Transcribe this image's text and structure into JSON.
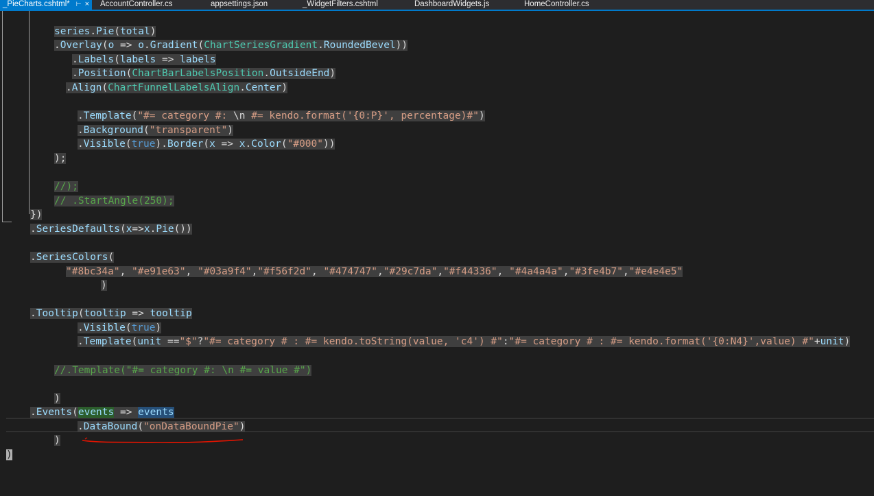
{
  "tabs": [
    {
      "label": "_PieCharts.cshtml*",
      "active": true,
      "pin_icon": "pin-icon",
      "close_icon": "close-icon"
    },
    {
      "label": "AccountController.cs"
    },
    {
      "label": "appsettings.json"
    },
    {
      "label": "_WidgetFilters.cshtml"
    },
    {
      "label": "DashboardWidgets.js"
    },
    {
      "label": "HomeController.cs"
    }
  ],
  "colors": {
    "background": "#1e1e1e",
    "tab_active": "#007acc",
    "selection": "#3f3f3f",
    "comment": "#57a64a",
    "string": "#d69d85",
    "keyword": "#569cd6",
    "type": "#4ec9b0",
    "identifier": "#9cdcfe",
    "annotation": "#e51400"
  },
  "code": {
    "l1": [
      "series",
      ".",
      "Pie",
      "(",
      "total",
      ")"
    ],
    "l2": [
      ".",
      "Overlay",
      "(",
      "o",
      " => ",
      "o",
      ".",
      "Gradient",
      "(",
      "ChartSeriesGradient",
      ".",
      "RoundedBevel",
      "))"
    ],
    "l3": [
      ".",
      "Labels",
      "(",
      "labels",
      " => ",
      "labels"
    ],
    "l4": [
      ".",
      "Position",
      "(",
      "ChartBarLabelsPosition",
      ".",
      "OutsideEnd",
      ")"
    ],
    "l5": [
      ".",
      "Align",
      "(",
      "ChartFunnelLabelsAlign",
      ".",
      "Center",
      ")"
    ],
    "l6": [
      ".",
      "Template",
      "(",
      "\"#= category #: ",
      "\\n",
      " #= kendo.format('{0:P}', percentage)#\"",
      ")"
    ],
    "l7": [
      ".",
      "Background",
      "(",
      "\"transparent\"",
      ")"
    ],
    "l8": [
      ".",
      "Visible",
      "(",
      "true",
      ")",
      ".",
      "Border",
      "(",
      "x",
      " => ",
      "x",
      ".",
      "Color",
      "(",
      "\"#000\"",
      "))"
    ],
    "l9": [
      ");"
    ],
    "l10": [
      "//);"
    ],
    "l11": [
      "// .StartAngle(250);"
    ],
    "l12": [
      "})"
    ],
    "l13": [
      ".",
      "SeriesDefaults",
      "(",
      "x",
      "=>",
      "x",
      ".",
      "Pie",
      "())"
    ],
    "l14": [
      ".",
      "SeriesColors",
      "("
    ],
    "l15": [
      "\"#8bc34a\"",
      ", ",
      "\"#e91e63\"",
      ", ",
      "\"#03a9f4\"",
      ",",
      "\"#f56f2d\"",
      ", ",
      "\"#474747\"",
      ",",
      "\"#29c7da\"",
      ",",
      "\"#f44336\"",
      ", ",
      "\"#4a4a4a\"",
      ",",
      "\"#3fe4b7\"",
      ",",
      "\"#e4e4e5\""
    ],
    "l16": [
      ")"
    ],
    "l17": [
      ".",
      "Tooltip",
      "(",
      "tooltip",
      " => ",
      "tooltip"
    ],
    "l18": [
      ".",
      "Visible",
      "(",
      "true",
      ")"
    ],
    "l19": [
      ".",
      "Template",
      "(",
      "unit",
      " ==",
      "\"$\"",
      "?",
      "\"#= category # : #= kendo.toString(value, 'c4') #\"",
      ":",
      "\"#= category # : #= kendo.format('{0:N4}',value) #\"",
      "+",
      "unit",
      ")"
    ],
    "l20": [
      "//.Template(\"#= category #: \\n #= value #\")"
    ],
    "l21": [
      ")"
    ],
    "l22": [
      ".",
      "Events",
      "(",
      "events",
      " => ",
      "events"
    ],
    "l23": [
      ".",
      "DataBound",
      "(",
      "\"onDataBoundPie\"",
      ")"
    ],
    "l24": [
      ")"
    ],
    "l25": [
      ")"
    ]
  }
}
